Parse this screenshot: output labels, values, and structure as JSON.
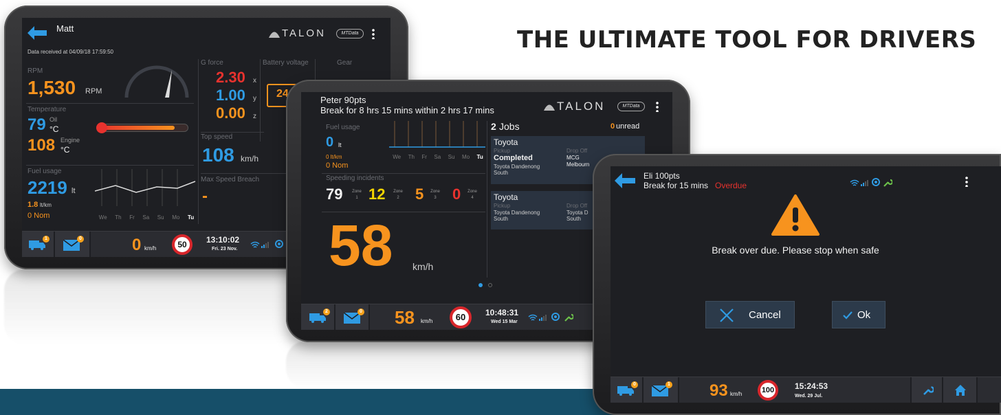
{
  "headline": "THE ULTIMATE TOOL FOR DRIVERS",
  "brand": {
    "talon": "TALON",
    "mtdata": "MTData"
  },
  "tablet1": {
    "driver": "Matt",
    "data_received": "Data received at 04/09/18 17:59:50",
    "rpm_label": "RPM",
    "rpm_value": "1,530",
    "rpm_unit": "RPM",
    "gforce_label": "G force",
    "gforce": [
      {
        "v": "2.30",
        "a": "x"
      },
      {
        "v": "1.00",
        "a": "y"
      },
      {
        "v": "0.00",
        "a": "z"
      }
    ],
    "battery_label": "Battery voltage",
    "battery_value": "24",
    "gear_label": "Gear",
    "temp_label": "Temperature",
    "oil_value": "79",
    "oil_label": "Oil",
    "oil_unit": "°C",
    "engine_value": "108",
    "engine_label": "Engine",
    "engine_unit": "°C",
    "topspeed_label": "Top speed",
    "topspeed_value": "108",
    "topspeed_unit": "km/h",
    "fuel_label": "Fuel usage",
    "fuel_value": "2219",
    "fuel_unit": "lt",
    "fuel_rate": "1.8",
    "fuel_rate_unit": "lt/km",
    "nom": "0 Nom",
    "maxbreach_label": "Max Speed Breach",
    "maxbreach_value": "-",
    "days": [
      "We",
      "Th",
      "Fr",
      "Sa",
      "Su",
      "Mo",
      "Tu"
    ],
    "bar": {
      "jobs_badge": "1",
      "msg_badge": "0",
      "speed": "0",
      "speed_unit": "km/h",
      "limit": "50",
      "time": "13:10:02",
      "date": "Fri. 23 Nov."
    }
  },
  "tablet2": {
    "driver": "Peter 90pts",
    "break_msg": "Break for 8 hrs 15 mins within 2 hrs 17 mins",
    "fuel_label": "Fuel usage",
    "fuel_value": "0",
    "fuel_unit": "lt",
    "fuel_rate": "0 lt/km",
    "nom": "0 Nom",
    "incidents_label": "Speeding incidents",
    "zones": [
      {
        "v": "79",
        "z": "Zone 1",
        "c": "white"
      },
      {
        "v": "12",
        "z": "Zone 2",
        "c": "yellow"
      },
      {
        "v": "5",
        "z": "Zone 3",
        "c": "orange"
      },
      {
        "v": "0",
        "z": "Zone 4",
        "c": "red"
      }
    ],
    "big_speed": "58",
    "big_speed_unit": "km/h",
    "days": [
      "We",
      "Th",
      "Fr",
      "Sa",
      "Su",
      "Mo",
      "Tu"
    ],
    "jobs_count": "2",
    "jobs_label": "Jobs",
    "unread_count": "0",
    "unread_label": "unread",
    "job1": {
      "title": "Toyota",
      "pickup_label": "Pickup",
      "status": "Completed",
      "pickup": "Toyota Dandenong South",
      "dropoff_label": "Drop Off",
      "dropoff1": "MCG",
      "dropoff2": "Melbourn"
    },
    "job2": {
      "title": "Toyota",
      "pickup_label": "Pickup",
      "pickup": "Toyota Dandenong South",
      "dropoff_label": "Drop Off",
      "dropoff": "Toyota D South"
    },
    "bar": {
      "jobs_badge": "2",
      "msg_badge": "0",
      "speed": "58",
      "speed_unit": "km/h",
      "limit": "60",
      "time": "10:48:31",
      "date": "Wed 15 Mar"
    }
  },
  "tablet3": {
    "driver": "Eli 100pts",
    "break_msg": "Break for 15 mins",
    "overdue": "Overdue",
    "alert_msg": "Break over due. Please stop when safe",
    "cancel": "Cancel",
    "ok": "Ok",
    "bar": {
      "jobs_badge": "0",
      "msg_badge": "1",
      "speed": "93",
      "speed_unit": "km/h",
      "limit": "100",
      "time": "15:24:53",
      "date": "Wed. 29 Jul."
    }
  },
  "colors": {
    "orange": "#f7931e",
    "blue": "#2f9be3",
    "red": "#e8322e",
    "yellow": "#f5d400",
    "band": "#164f69",
    "screen": "#1e1f23"
  },
  "icons": [
    "back-arrow-icon",
    "kebab-menu-icon",
    "truck-icon",
    "mail-icon",
    "wifi-icon",
    "signal-icon",
    "gps-icon",
    "wrench-icon",
    "home-icon",
    "warning-icon",
    "close-icon",
    "check-icon",
    "battery-icon",
    "talon-logo-icon"
  ]
}
